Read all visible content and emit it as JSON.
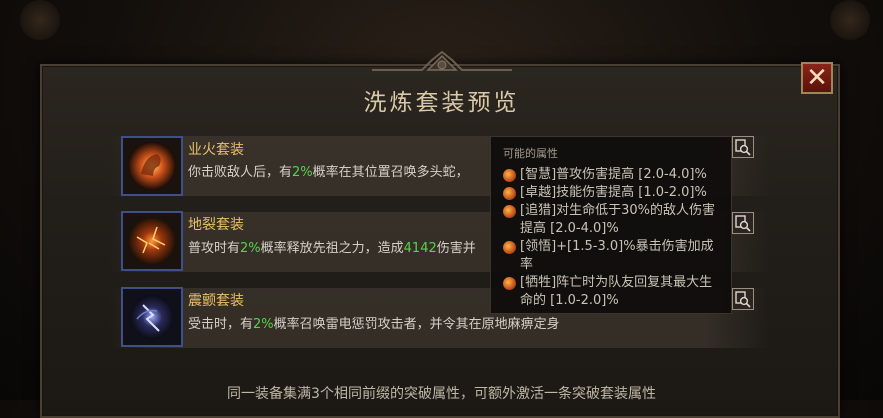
{
  "dialog": {
    "title": "洗炼套装预览",
    "close_label": "✕",
    "footer_text": "同一装备集满3个相同前缀的突破属性，可额外激活一条突破套装属性"
  },
  "sets": [
    {
      "name": "业火套装",
      "desc_pre": "你击败敌人后，有",
      "desc_chance": "2%",
      "desc_post": "概率在其位置召唤多头蛇，",
      "icon": "fire-dragon-icon"
    },
    {
      "name": "地裂套装",
      "desc_pre": "普攻时有",
      "desc_chance": "2%",
      "desc_mid": "概率释放先祖之力，造成",
      "desc_value": "4142",
      "desc_post": "伤害并",
      "icon": "lava-rock-icon"
    },
    {
      "name": "震颤套装",
      "desc_pre": "受击时，有",
      "desc_chance": "2%",
      "desc_post": "概率召唤雷电惩罚攻击者，并令其在原地麻痹定身",
      "icon": "lightning-orb-icon"
    }
  ],
  "tooltip": {
    "header": "可能的属性",
    "lines": [
      "[智慧]普攻伤害提高 [2.0-4.0]%",
      "[卓越]技能伤害提高 [1.0-2.0]%",
      "[追猎]对生命低于30%的敌人伤害提高 [2.0-4.0]%",
      "[领悟]+[1.5-3.0]%暴击伤害加成率",
      "[牺牲]阵亡时为队友回复其最大生命的 [1.0-2.0]%"
    ]
  },
  "colors": {
    "gold": "#e8c06a",
    "green": "#58d24a",
    "close_red": "#8a2418"
  }
}
